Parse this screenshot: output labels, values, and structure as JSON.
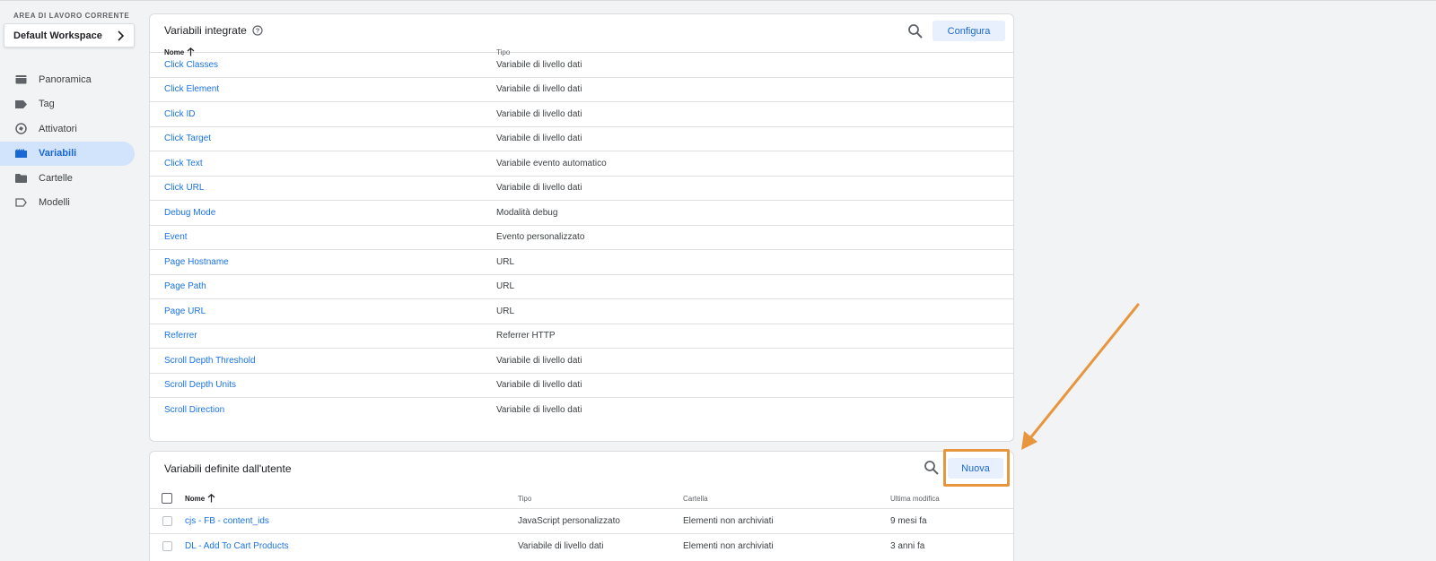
{
  "sidebar": {
    "workspace_label": "AREA DI LAVORO CORRENTE",
    "workspace_name": "Default Workspace",
    "items": [
      {
        "label": "Panoramica",
        "icon": "briefcase-icon"
      },
      {
        "label": "Tag",
        "icon": "tag-icon"
      },
      {
        "label": "Attivatori",
        "icon": "trigger-icon"
      },
      {
        "label": "Variabili",
        "icon": "variables-icon",
        "active": true
      },
      {
        "label": "Cartelle",
        "icon": "folder-icon"
      },
      {
        "label": "Modelli",
        "icon": "template-icon"
      }
    ]
  },
  "builtin": {
    "title": "Variabili integrate",
    "configure_label": "Configura",
    "col_name": "Nome",
    "col_type": "Tipo",
    "rows": [
      {
        "name": "Click Classes",
        "type": "Variabile di livello dati"
      },
      {
        "name": "Click Element",
        "type": "Variabile di livello dati"
      },
      {
        "name": "Click ID",
        "type": "Variabile di livello dati"
      },
      {
        "name": "Click Target",
        "type": "Variabile di livello dati"
      },
      {
        "name": "Click Text",
        "type": "Variabile evento automatico"
      },
      {
        "name": "Click URL",
        "type": "Variabile di livello dati"
      },
      {
        "name": "Debug Mode",
        "type": "Modalità debug"
      },
      {
        "name": "Event",
        "type": "Evento personalizzato"
      },
      {
        "name": "Page Hostname",
        "type": "URL"
      },
      {
        "name": "Page Path",
        "type": "URL"
      },
      {
        "name": "Page URL",
        "type": "URL"
      },
      {
        "name": "Referrer",
        "type": "Referrer HTTP"
      },
      {
        "name": "Scroll Depth Threshold",
        "type": "Variabile di livello dati"
      },
      {
        "name": "Scroll Depth Units",
        "type": "Variabile di livello dati"
      },
      {
        "name": "Scroll Direction",
        "type": "Variabile di livello dati"
      }
    ]
  },
  "user": {
    "title": "Variabili definite dall'utente",
    "new_label": "Nuova",
    "col_name": "Nome",
    "col_type": "Tipo",
    "col_folder": "Cartella",
    "col_modified": "Ultima modifica",
    "rows": [
      {
        "name": "cjs - FB - content_ids",
        "type": "JavaScript personalizzato",
        "folder": "Elementi non archiviati",
        "modified": "9 mesi fa"
      },
      {
        "name": "DL - Add To Cart Products",
        "type": "Variabile di livello dati",
        "folder": "Elementi non archiviati",
        "modified": "3 anni fa"
      }
    ]
  },
  "colors": {
    "accent": "#1a73e8",
    "active_nav_bg": "#d2e3fc",
    "annotation": "#e8963d"
  }
}
